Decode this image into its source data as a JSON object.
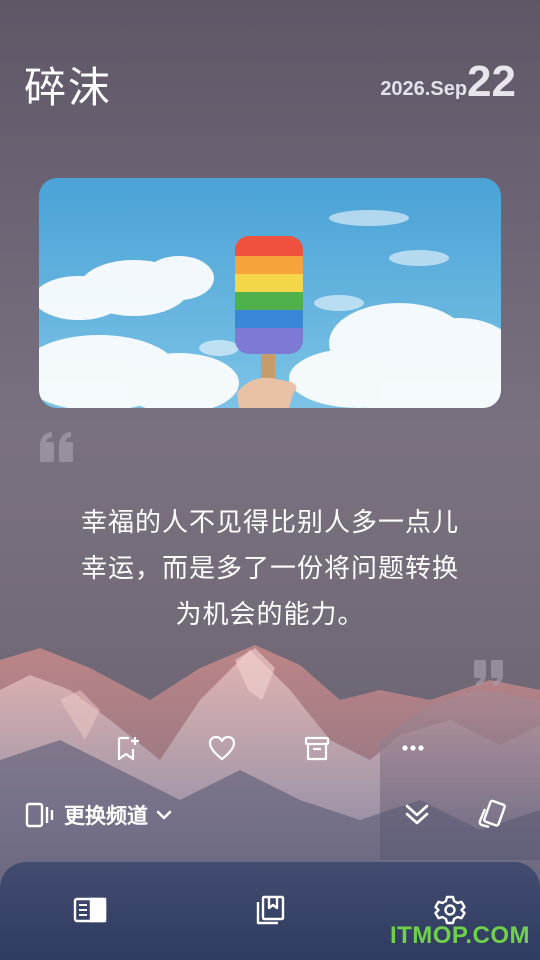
{
  "header": {
    "app_title": "碎沫",
    "date_year_month": "2026.Sep",
    "date_day": "22"
  },
  "card": {
    "image_subject": "rainbow popsicle against blue sky with clouds"
  },
  "quote": {
    "line1": "幸福的人不见得比别人多一点儿",
    "line2": "幸运，而是多了一份将问题转换",
    "line3": "为机会的能力。"
  },
  "actions": {
    "icons": [
      "bookmark-add-icon",
      "heart-icon",
      "archive-icon",
      "more-icon"
    ]
  },
  "channel": {
    "label": "更换频道",
    "icons": [
      "channel-icon",
      "chevron-down-icon",
      "double-chevron-down-icon",
      "cards-icon"
    ]
  },
  "bottom_nav": {
    "icons": [
      "reader-icon",
      "collections-icon",
      "gear-icon"
    ]
  },
  "watermark": "ITMOP.COM",
  "colors": {
    "nav_bg": "#2e3a60",
    "watermark": "#6fd14a",
    "text": "#ffffff"
  }
}
